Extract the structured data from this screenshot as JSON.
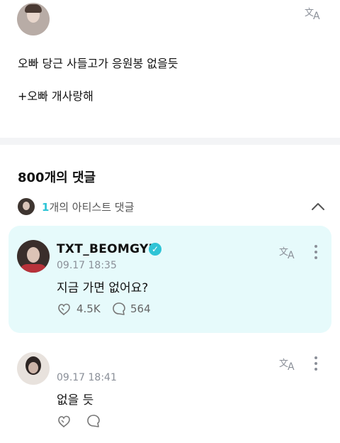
{
  "post": {
    "line1": "오빠 당근 사들고가 응원봉 없을듯",
    "line2": "+오빠 개사랑해"
  },
  "comments_header": "800개의 댓글",
  "artist_comments": {
    "count": "1",
    "label": "개의 아티스트 댓글"
  },
  "icons": {
    "translate": "translate-icon",
    "chevron": "chevron-up-icon",
    "like": "like-icon",
    "reply": "reply-icon",
    "more": "more-icon",
    "verified": "verified-badge-icon"
  },
  "artist_comment": {
    "username": "TXT_BEOMGYU",
    "timestamp": "09.17 18:35",
    "text": "지금 가면 없어요?",
    "likes": "4.5K",
    "replies": "564"
  },
  "reply_comment": {
    "timestamp": "09.17 18:41",
    "text": "없을 듯"
  },
  "colors": {
    "accent": "#2ec4d6",
    "artist_card_bg": "#e6fafb",
    "muted": "#8a8f98"
  }
}
